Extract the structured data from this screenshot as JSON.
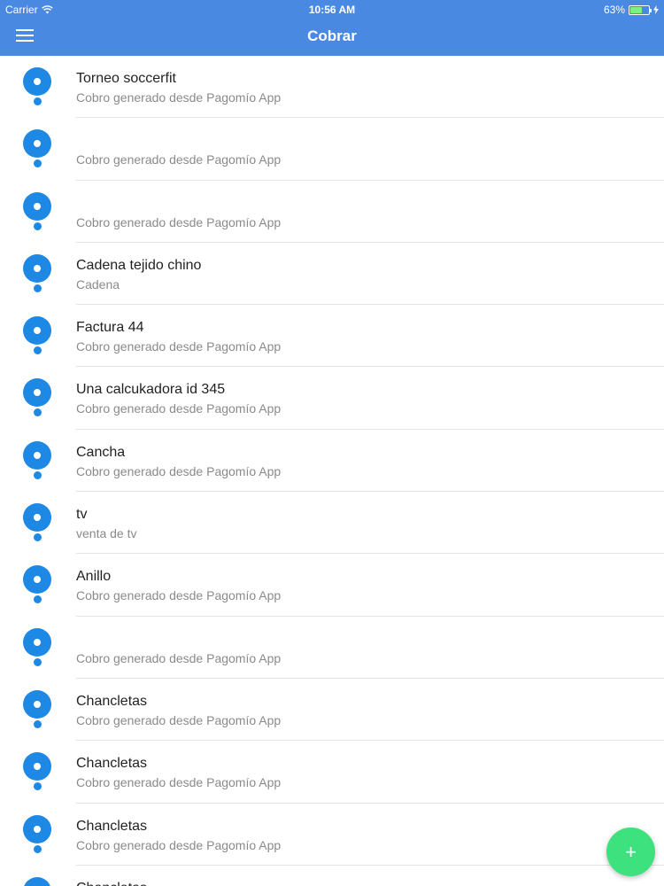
{
  "status_bar": {
    "carrier": "Carrier",
    "time": "10:56 AM",
    "battery_text": "63%",
    "battery_level": 0.63
  },
  "header": {
    "title": "Cobrar",
    "color": "#4a89e2"
  },
  "charges": [
    {
      "title": "Torneo soccerfit",
      "subtitle": "Cobro generado desde Pagomío App"
    },
    {
      "title": "",
      "subtitle": "Cobro generado desde Pagomío App"
    },
    {
      "title": "",
      "subtitle": "Cobro generado desde Pagomío App"
    },
    {
      "title": "Cadena tejido chino",
      "subtitle": "Cadena"
    },
    {
      "title": "Factura 44",
      "subtitle": "Cobro generado desde Pagomío App"
    },
    {
      "title": "Una calcukadora id 345",
      "subtitle": "Cobro generado desde Pagomío App"
    },
    {
      "title": "Cancha",
      "subtitle": "Cobro generado desde Pagomío App"
    },
    {
      "title": "tv",
      "subtitle": "venta de tv"
    },
    {
      "title": "Anillo",
      "subtitle": "Cobro generado desde Pagomío App"
    },
    {
      "title": "",
      "subtitle": "Cobro generado desde Pagomío App"
    },
    {
      "title": "Chancletas",
      "subtitle": "Cobro generado desde Pagomío App"
    },
    {
      "title": "Chancletas",
      "subtitle": "Cobro generado desde Pagomío App"
    },
    {
      "title": "Chancletas",
      "subtitle": "Cobro generado desde Pagomío App"
    },
    {
      "title": "Chancletas",
      "subtitle": ""
    }
  ],
  "icons": {
    "menu": "hamburger-menu-icon",
    "row": "location-pin-icon",
    "fab": "plus-icon"
  },
  "fab": {
    "symbol": "+",
    "color": "#3de27e"
  }
}
